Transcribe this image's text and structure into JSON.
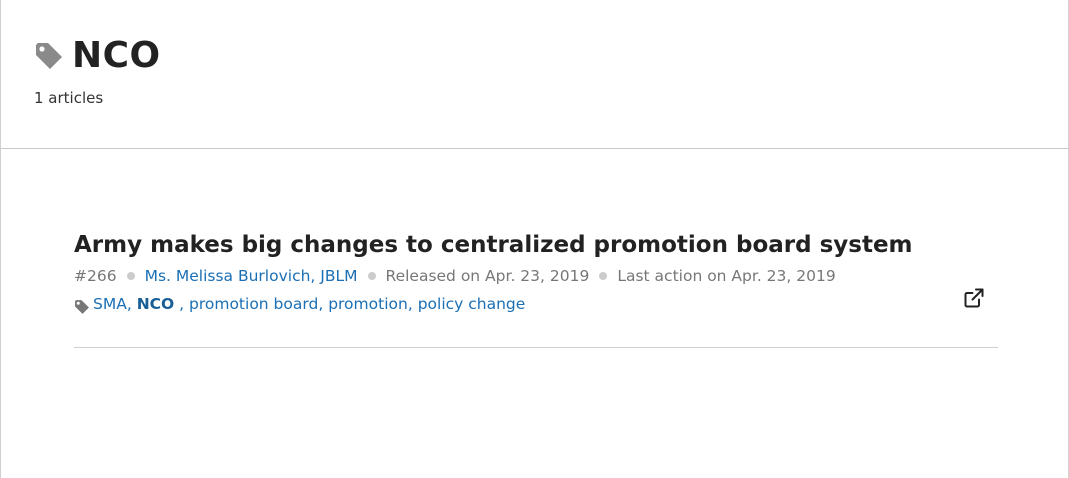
{
  "header": {
    "title": "NCO",
    "count_label": "1 articles"
  },
  "article": {
    "title": "Army makes big changes to centralized promotion board system",
    "number": "#266",
    "author": "Ms. Melissa Burlovich, JBLM",
    "released": "Released on Apr. 23, 2019",
    "last_action": "Last action on Apr. 23, 2019",
    "tags": [
      {
        "label": "SMA",
        "suffix": ", "
      },
      {
        "label": "NCO",
        "suffix": " , "
      },
      {
        "label": "promotion board",
        "suffix": ", "
      },
      {
        "label": "promotion",
        "suffix": ", "
      },
      {
        "label": "policy change",
        "suffix": ""
      }
    ]
  },
  "icons": {
    "title_icon": "tag-icon",
    "tags_icon": "tag-icon",
    "external": "external-link-icon"
  },
  "colors": {
    "link": "#1a6fb5",
    "text": "#222222",
    "muted": "#777777"
  }
}
